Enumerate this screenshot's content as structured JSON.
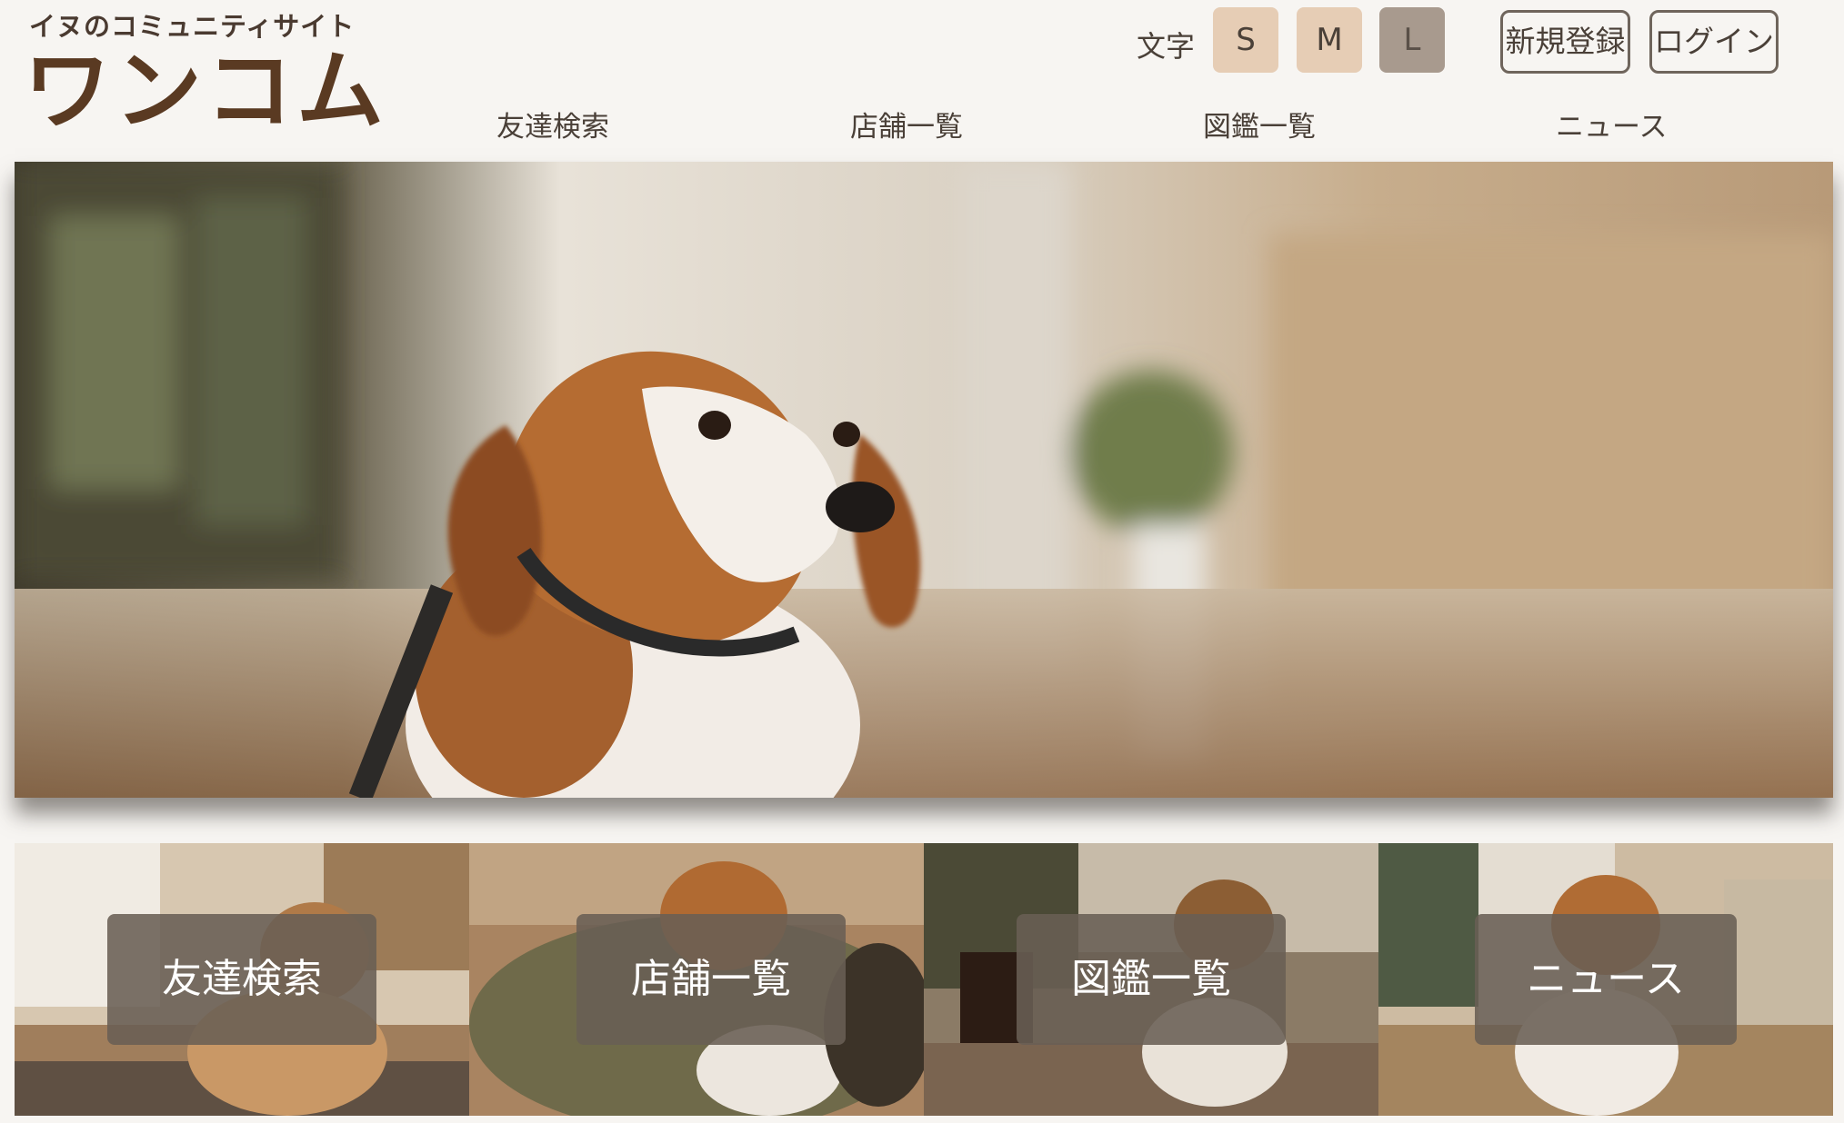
{
  "logo": {
    "tagline": "イヌのコミュニティサイト",
    "name": "ワンコム"
  },
  "font_size_switcher": {
    "label": "文字",
    "options": [
      "S",
      "M",
      "L"
    ],
    "selected": "L"
  },
  "auth": {
    "register": "新規登録",
    "login": "ログイン"
  },
  "nav": {
    "items": [
      "友達検索",
      "店舗一覧",
      "図鑑一覧",
      "ニュース"
    ]
  },
  "tiles": [
    {
      "label": "友達検索"
    },
    {
      "label": "店舗一覧"
    },
    {
      "label": "図鑑一覧"
    },
    {
      "label": "ニュース"
    }
  ],
  "colors": {
    "background": "#f7f5f2",
    "text": "#4a4038",
    "logo": "#5a3a22",
    "font_button": "#e6cdb5",
    "font_button_selected": "#a89a8e",
    "tile_label_bg": "#695e54"
  }
}
